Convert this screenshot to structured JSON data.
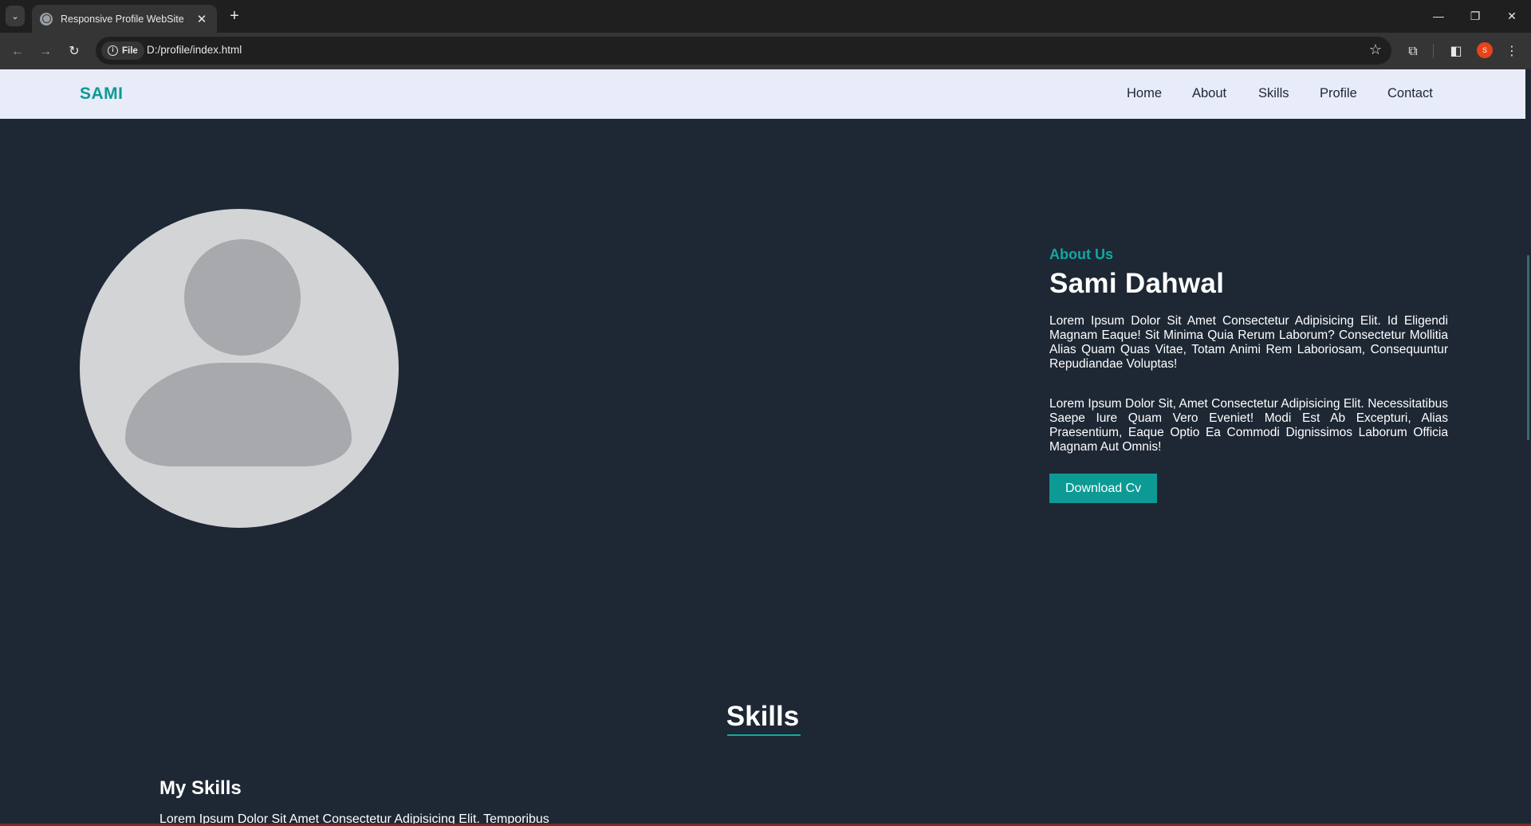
{
  "browser": {
    "tab_title": "Responsive Profile WebSite",
    "chip_label": "File",
    "url": "D:/profile/index.html",
    "profile_initial": "S"
  },
  "site": {
    "logo": "SAMI",
    "nav": [
      "Home",
      "About",
      "Skills",
      "Profile",
      "Contact"
    ]
  },
  "about": {
    "kicker": "About Us",
    "name": "Sami Dahwal",
    "paragraph_1": "Lorem Ipsum Dolor Sit Amet Consectetur Adipisicing Elit. Id Eligendi Magnam Eaque! Sit Minima Quia Rerum Laborum? Consectetur Mollitia Alias Quam Quas Vitae, Totam Animi Rem Laboriosam, Consequuntur Repudiandae Voluptas!",
    "paragraph_2": "Lorem Ipsum Dolor Sit, Amet Consectetur Adipisicing Elit. Necessitatibus Saepe Iure Quam Vero Eveniet! Modi Est Ab Excepturi, Alias Praesentium, Eaque Optio Ea Commodi Dignissimos Laborum Officia Magnam Aut Omnis!",
    "button": "Download Cv"
  },
  "skills": {
    "title": "Skills",
    "subtitle": "My Skills",
    "text": "Lorem Ipsum Dolor Sit Amet Consectetur Adipisicing Elit. Temporibus"
  },
  "colors": {
    "accent": "#0d9a94",
    "background": "#1e2734",
    "navbar": "#e8ebf8"
  }
}
